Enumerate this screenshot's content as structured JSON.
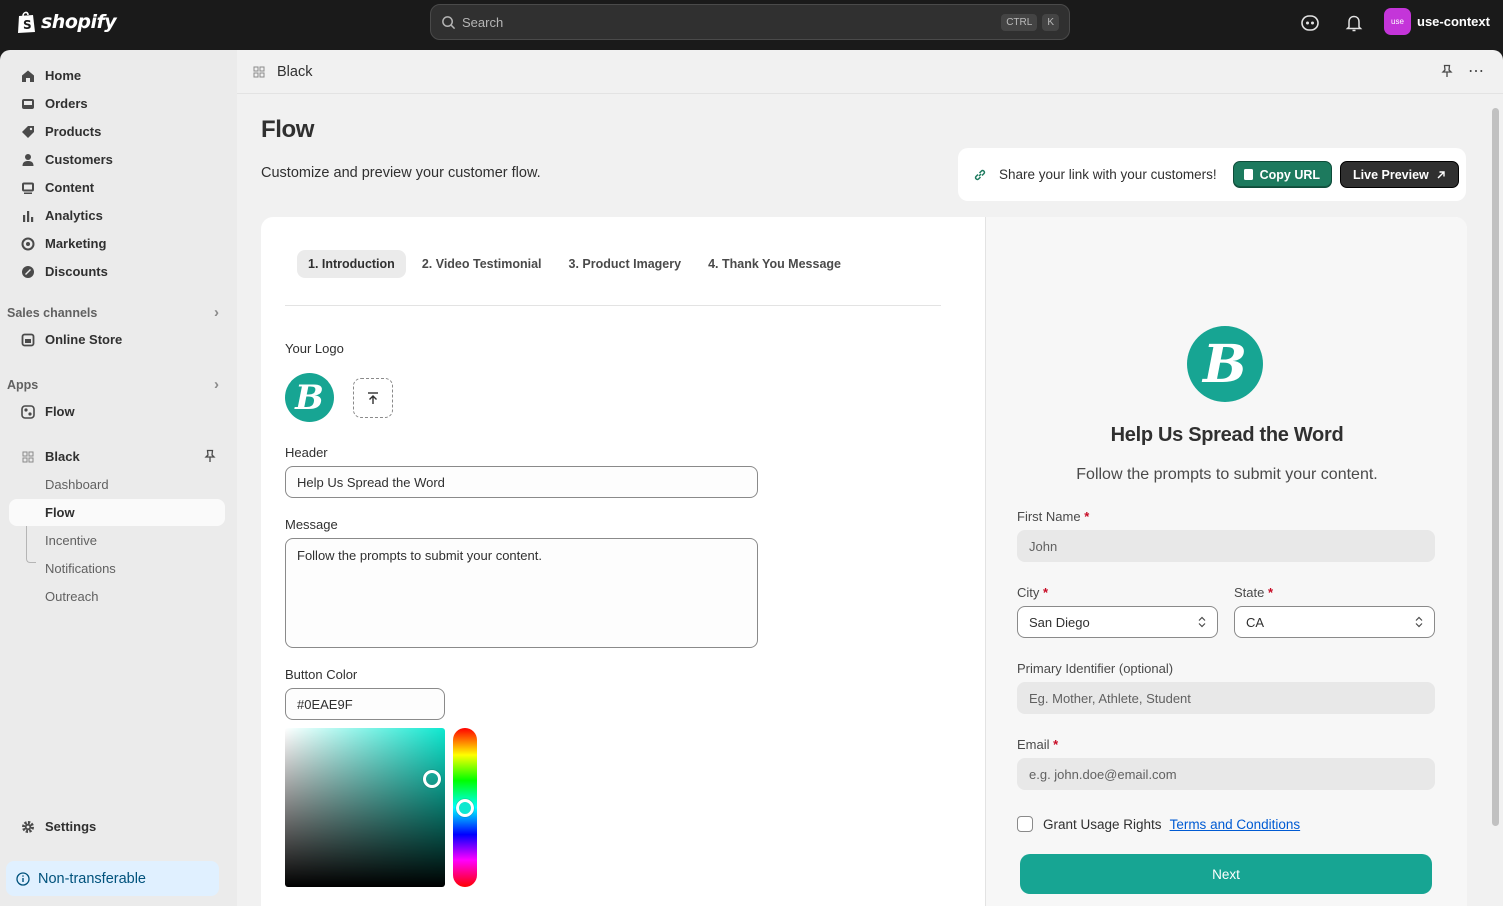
{
  "topbar": {
    "brand": "shopify",
    "search_placeholder": "Search",
    "shortcut_keys": [
      "CTRL",
      "K"
    ],
    "avatar_initials": "use",
    "user_name": "use-context",
    "avatar_color": "#c435d9"
  },
  "sidebar": {
    "items": [
      {
        "label": "Home",
        "icon": "home-icon"
      },
      {
        "label": "Orders",
        "icon": "inbox-icon"
      },
      {
        "label": "Products",
        "icon": "tag-icon"
      },
      {
        "label": "Customers",
        "icon": "person-icon"
      },
      {
        "label": "Content",
        "icon": "image-icon"
      },
      {
        "label": "Analytics",
        "icon": "bar-chart-icon"
      },
      {
        "label": "Marketing",
        "icon": "target-icon"
      },
      {
        "label": "Discounts",
        "icon": "discount-icon"
      }
    ],
    "sales_channels_heading": "Sales channels",
    "online_store": "Online Store",
    "apps_heading": "Apps",
    "flow_app": "Flow",
    "black_app": "Black",
    "black_subitems": [
      "Dashboard",
      "Flow",
      "Incentive",
      "Notifications",
      "Outreach"
    ],
    "active_subitem": "Flow",
    "settings": "Settings",
    "non_transferable": "Non-transferable"
  },
  "breadcrumb": {
    "title": "Black"
  },
  "page": {
    "title": "Flow",
    "subtitle": "Customize and preview your customer flow."
  },
  "share": {
    "text": "Share your link with your customers!",
    "copy_label": "Copy URL",
    "live_label": "Live Preview"
  },
  "tabs": [
    {
      "label": "1. Introduction",
      "active": true
    },
    {
      "label": "2. Video Testimonial",
      "active": false
    },
    {
      "label": "3. Product Imagery",
      "active": false
    },
    {
      "label": "4. Thank You Message",
      "active": false
    }
  ],
  "form": {
    "logo_label": "Your Logo",
    "header_label": "Header",
    "header_value": "Help Us Spread the Word",
    "message_label": "Message",
    "message_value": "Follow the prompts to submit your content.",
    "button_color_label": "Button Color",
    "button_color_value": "#0EAE9F"
  },
  "preview": {
    "logo_letter": "B",
    "title": "Help Us Spread the Word",
    "subtitle": "Follow the prompts to submit your content.",
    "first_name_label": "First Name",
    "first_name_placeholder": "John",
    "city_label": "City",
    "city_value": "San Diego",
    "state_label": "State",
    "state_value": "CA",
    "identifier_label": "Primary Identifier (optional)",
    "identifier_placeholder": "Eg. Mother, Athlete, Student",
    "email_label": "Email",
    "email_placeholder": "e.g. john.doe@email.com",
    "required_mark": "*",
    "grant_label": "Grant Usage Rights",
    "terms_link": "Terms and Conditions",
    "next_label": "Next",
    "accent_color": "#17a593"
  }
}
